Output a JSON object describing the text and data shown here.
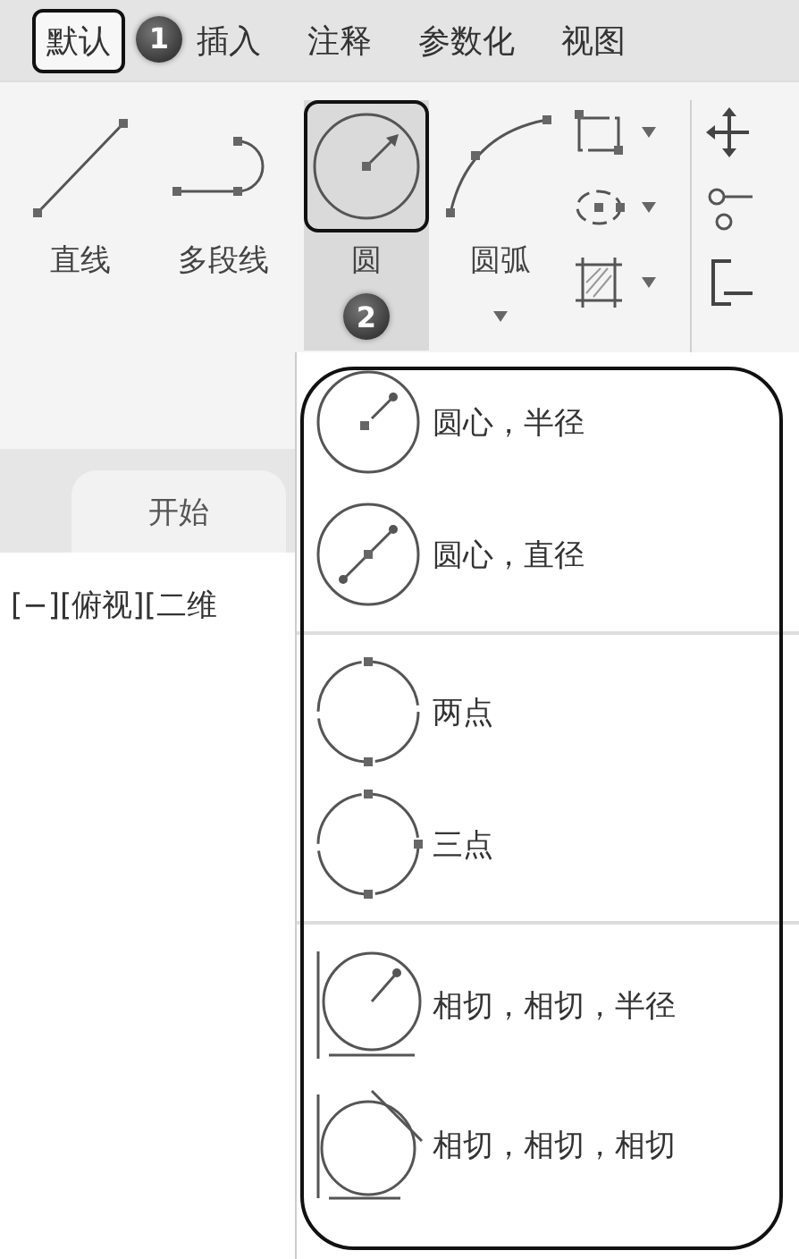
{
  "tabs": [
    {
      "label": "默认",
      "selected": true,
      "framed": true,
      "callout": "1"
    },
    {
      "label": "插入",
      "selected": false,
      "framed": false
    },
    {
      "label": "注释",
      "selected": false,
      "framed": false
    },
    {
      "label": "参数化",
      "selected": false,
      "framed": false
    },
    {
      "label": "视图",
      "selected": false,
      "framed": false
    }
  ],
  "tools": [
    {
      "kind": "line",
      "label": "直线"
    },
    {
      "kind": "polyline",
      "label": "多段线"
    },
    {
      "kind": "circle",
      "label": "圆",
      "highlighted": true,
      "framed": true,
      "callout": "2"
    },
    {
      "kind": "arc",
      "label": "圆弧",
      "dropdown": true
    }
  ],
  "small_tools": [
    {
      "kind": "rectangle"
    },
    {
      "kind": "ellipse"
    },
    {
      "kind": "hatch"
    }
  ],
  "file_tab": {
    "label": "开始"
  },
  "viewport_label": "[−][俯视][二维",
  "dropdown": {
    "framed": true,
    "groups": [
      {
        "items": [
          {
            "kind": "center-radius",
            "label": "圆心，半径"
          },
          {
            "kind": "center-diameter",
            "label": "圆心，直径"
          }
        ]
      },
      {
        "items": [
          {
            "kind": "two-point",
            "label": "两点"
          },
          {
            "kind": "three-point",
            "label": "三点"
          }
        ]
      },
      {
        "items": [
          {
            "kind": "tan-tan-radius",
            "label": "相切，相切，半径"
          },
          {
            "kind": "tan-tan-tan",
            "label": "相切，相切，相切"
          }
        ]
      }
    ]
  }
}
